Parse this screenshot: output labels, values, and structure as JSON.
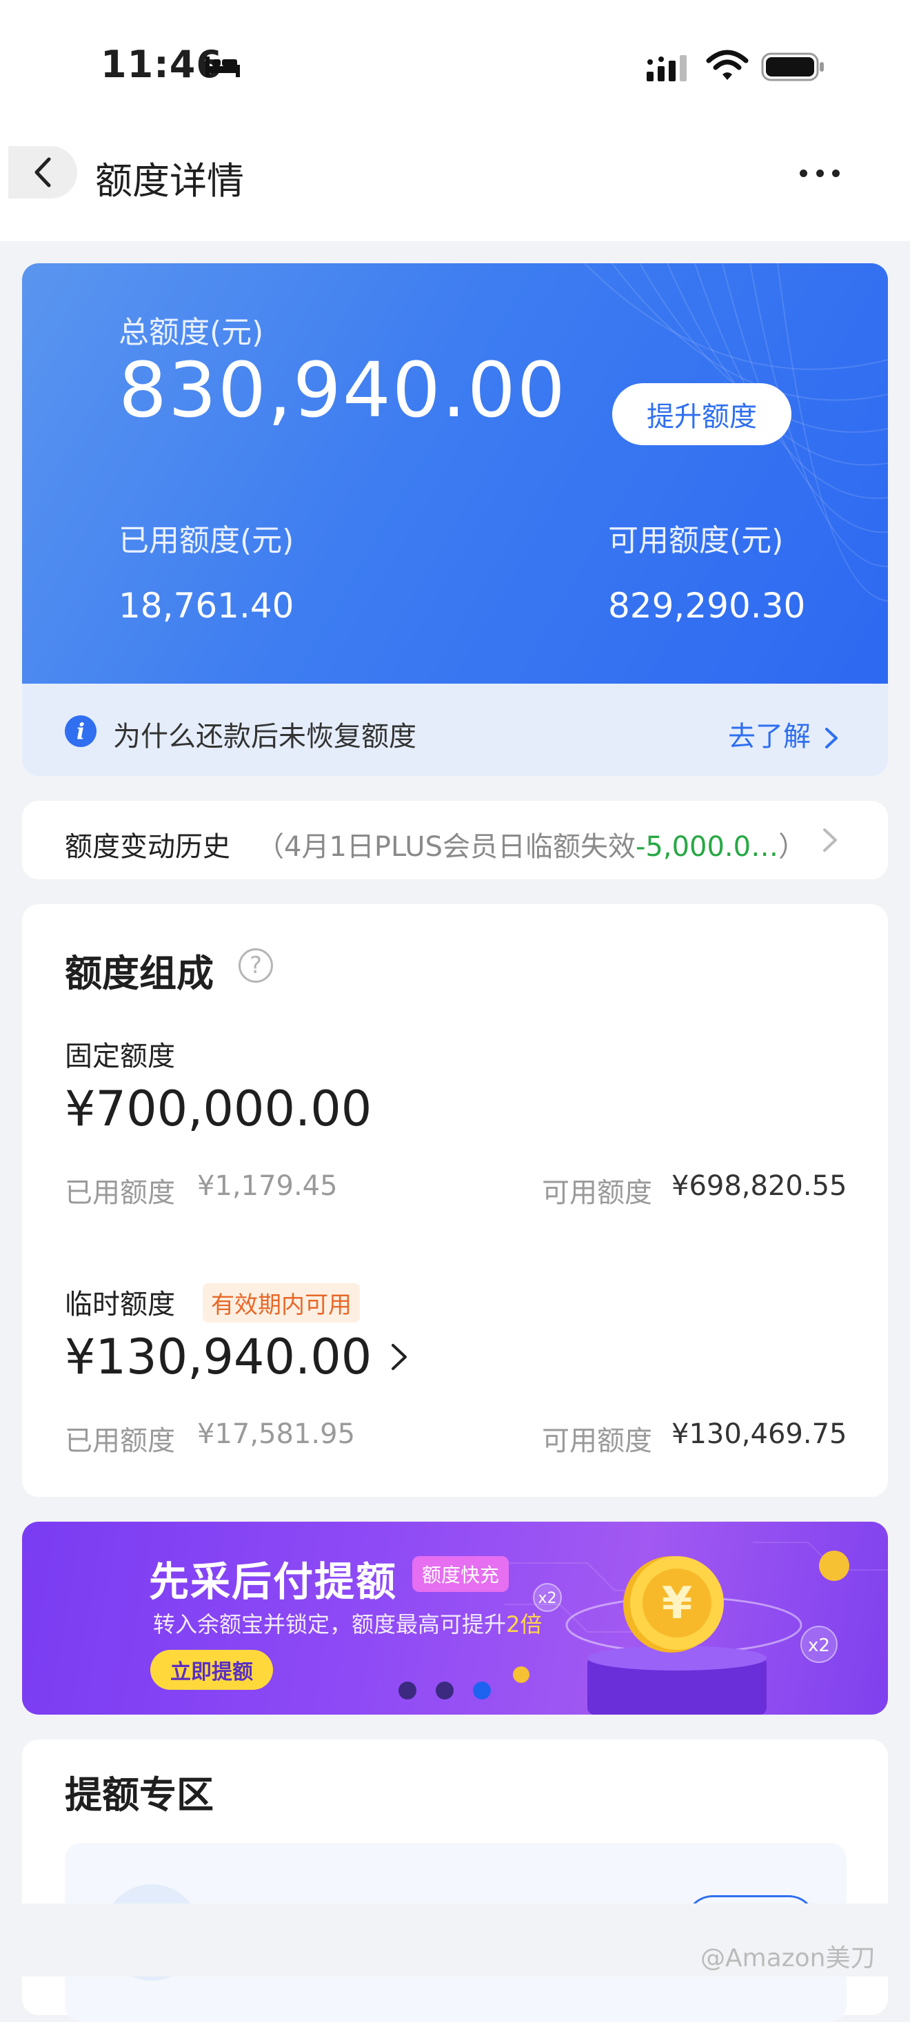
{
  "status_bar": {
    "time": "11:46"
  },
  "nav": {
    "title": "额度详情"
  },
  "quota": {
    "total_label": "总额度(元)",
    "total_value": "830,940.00",
    "raise_button": "提升额度",
    "used_label": "已用额度(元)",
    "used_value": "18,761.40",
    "available_label": "可用额度(元)",
    "available_value": "829,290.30"
  },
  "tip": {
    "text": "为什么还款后未恢复额度",
    "link": "去了解"
  },
  "history": {
    "label": "额度变动历史",
    "detail_prefix": "（4月1日PLUS会员日临额失效",
    "detail_amount": "-5,000.0…",
    "detail_suffix": "）"
  },
  "composition": {
    "title": "额度组成",
    "help_icon": "?",
    "fixed": {
      "label": "固定额度",
      "amount": "¥700,000.00",
      "used_label": "已用额度",
      "used_value": "¥1,179.45",
      "available_label": "可用额度",
      "available_value": "¥698,820.55"
    },
    "temp": {
      "label": "临时额度",
      "tag": "有效期内可用",
      "amount": "¥130,940.00",
      "used_label": "已用额度",
      "used_value": "¥17,581.95",
      "available_label": "可用额度",
      "available_value": "¥130,469.75"
    }
  },
  "banner": {
    "title": "先采后付提额",
    "tag": "额度快充",
    "subtitle_prefix": "转入余额宝并锁定，额度最高可提升",
    "subtitle_highlight": "2倍",
    "button": "立即提额",
    "coin_symbol": "¥",
    "badge_1": "x2",
    "badge_2": "x2",
    "carousel_pages": 3,
    "carousel_active_index": 2
  },
  "zone": {
    "title": "提额专区"
  },
  "watermark": "@Amazon美刀",
  "colors": {
    "primary": "#2f6ff0",
    "green": "#27a844",
    "tag_orange": "#e8682a",
    "banner_purple": "#8e4af5"
  }
}
